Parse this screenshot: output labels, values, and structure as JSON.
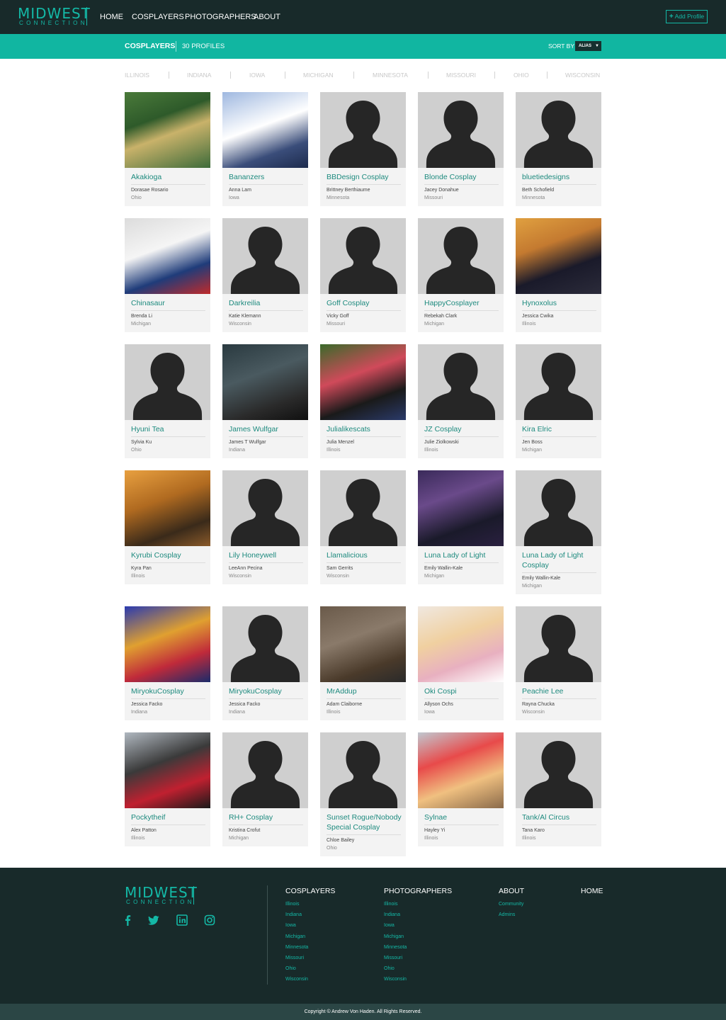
{
  "logo": {
    "main": "MIDWEST",
    "sub": "CONNECTION"
  },
  "nav": [
    "HOME",
    "COSPLAYERS",
    "PHOTOGRAPHERS",
    "ABOUT"
  ],
  "add_profile": {
    "icon": "plus-icon",
    "label": "Add Profile"
  },
  "subheader": {
    "title": "COSPLAYERS",
    "count": "30 PROFILES",
    "sort_label": "SORT BY",
    "sort_value": "ALIAS"
  },
  "states": [
    "ILLINOIS",
    "INDIANA",
    "IOWA",
    "MICHIGAN",
    "MINNESOTA",
    "MISSOURI",
    "OHIO",
    "WISCONSIN"
  ],
  "profiles": [
    {
      "alias": "Akakioga",
      "name": "Dorasae Rosario",
      "state": "Ohio",
      "photo": true
    },
    {
      "alias": "Bananzers",
      "name": "Anna Lam",
      "state": "Iowa",
      "photo": true
    },
    {
      "alias": "BBDesign Cosplay",
      "name": "Brittney Berthiaume",
      "state": "Minnesota",
      "photo": false
    },
    {
      "alias": "Blonde Cosplay",
      "name": "Jacey Donahue",
      "state": "Missouri",
      "photo": false
    },
    {
      "alias": "bluetiedesigns",
      "name": "Beth Schofield",
      "state": "Minnesota",
      "photo": false
    },
    {
      "alias": "Chinasaur",
      "name": "Brenda Li",
      "state": "Michigan",
      "photo": true
    },
    {
      "alias": "Darkreilia",
      "name": "Katie Klemann",
      "state": "Wisconsin",
      "photo": false
    },
    {
      "alias": "Goff Cosplay",
      "name": "Vicky Goff",
      "state": "Missouri",
      "photo": false
    },
    {
      "alias": "HappyCosplayer",
      "name": "Rebekah Clark",
      "state": "Michigan",
      "photo": false
    },
    {
      "alias": "Hynoxolus",
      "name": "Jessica Cwika",
      "state": "Illinois",
      "photo": true
    },
    {
      "alias": "Hyuni Tea",
      "name": "Sylvia Ku",
      "state": "Ohio",
      "photo": false
    },
    {
      "alias": "James Wulfgar",
      "name": "James T Wulfgar",
      "state": "Indiana",
      "photo": true
    },
    {
      "alias": "Julialikescats",
      "name": "Julia Menzel",
      "state": "Illinois",
      "photo": true
    },
    {
      "alias": "JZ Cosplay",
      "name": "Julie Ziolkowski",
      "state": "Illinois",
      "photo": false
    },
    {
      "alias": "Kira Elric",
      "name": "Jen Boss",
      "state": "Michigan",
      "photo": false
    },
    {
      "alias": "Kyrubi Cosplay",
      "name": "Kyra Pan",
      "state": "Illinois",
      "photo": true
    },
    {
      "alias": "Lily Honeywell",
      "name": "LeeAnn Pecina",
      "state": "Wisconsin",
      "photo": false
    },
    {
      "alias": "Llamalicious",
      "name": "Sam Gerrits",
      "state": "Wisconsin",
      "photo": false
    },
    {
      "alias": "Luna Lady of Light",
      "name": "Emily Wallin-Kale",
      "state": "Michigan",
      "photo": true
    },
    {
      "alias": "Luna Lady of Light Cosplay",
      "name": "Emily Wallin-Kale",
      "state": "Michigan",
      "photo": false
    },
    {
      "alias": "MiryokuCosplay",
      "name": "Jessica Facko",
      "state": "Indiana",
      "photo": true
    },
    {
      "alias": "MiryokuCosplay",
      "name": "Jessica Facko",
      "state": "Indiana",
      "photo": false
    },
    {
      "alias": "MrAddup",
      "name": "Adam Claiborne",
      "state": "Illinois",
      "photo": true
    },
    {
      "alias": "Oki Cospi",
      "name": "Allyson Ochs",
      "state": "Iowa",
      "photo": true
    },
    {
      "alias": "Peachie Lee",
      "name": "Rayna Chucka",
      "state": "Wisconsin",
      "photo": false
    },
    {
      "alias": "Pockytheif",
      "name": "Alex Patton",
      "state": "Illinois",
      "photo": true
    },
    {
      "alias": "RH+ Cosplay",
      "name": "Kristina Crofut",
      "state": "Michigan",
      "photo": false
    },
    {
      "alias": "Sunset Rogue/Nobody Special Cosplay",
      "name": "Chloe Bailey",
      "state": "Ohio",
      "photo": false
    },
    {
      "alias": "Sylnae",
      "name": "Hayley Yi",
      "state": "Illinois",
      "photo": true
    },
    {
      "alias": "Tank/Al Circus",
      "name": "Tana Karo",
      "state": "Illinois",
      "photo": false
    }
  ],
  "footer": {
    "social": [
      "facebook-icon",
      "twitter-icon",
      "linkedin-icon",
      "instagram-icon"
    ],
    "cosplayers": {
      "title": "COSPLAYERS",
      "links": [
        "Illinois",
        "Indiana",
        "Iowa",
        "Michigan",
        "Minnesota",
        "Missouri",
        "Ohio",
        "Wisconsin"
      ]
    },
    "photographers": {
      "title": "PHOTOGRAPHERS",
      "links": [
        "Illinois",
        "Indiana",
        "Iowa",
        "Michigan",
        "Minnesota",
        "Missouri",
        "Ohio",
        "Wisconsin"
      ]
    },
    "about": {
      "title": "ABOUT",
      "links": [
        "Community",
        "Admins"
      ]
    },
    "home": {
      "title": "HOME"
    },
    "copyright": "Copyright © Andrew Von Haden. All Rights Reserved."
  },
  "colors": {
    "accent": "#11b6a1",
    "dark": "#182a2a",
    "alias_text": "#1d8a7e",
    "card_bg": "#f3f3f3",
    "placeholder_bg": "#cfcfcf",
    "silhouette": "#262626"
  }
}
